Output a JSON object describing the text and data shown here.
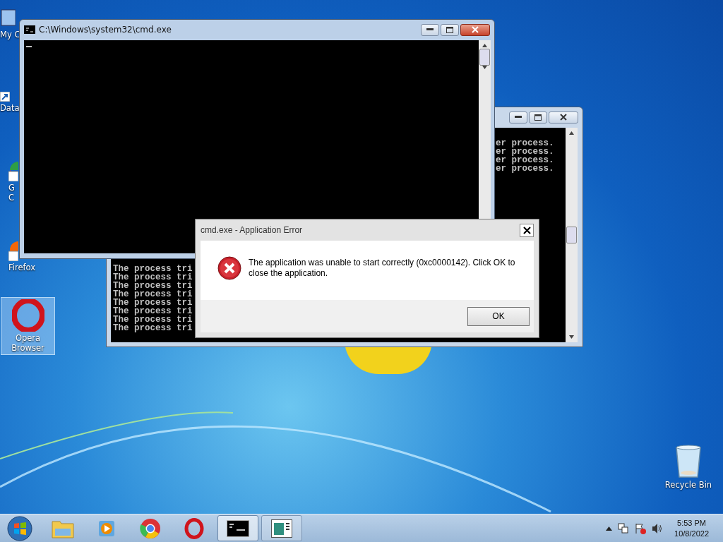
{
  "desktop_icons": [
    {
      "kind": "computer",
      "label": "My C",
      "selected": false
    },
    {
      "kind": "shortcut",
      "label": "Data",
      "selected": false
    },
    {
      "kind": "chrome",
      "label": "G\nC",
      "selected": false
    },
    {
      "kind": "firefox",
      "label": "Firefox",
      "selected": false
    },
    {
      "kind": "opera",
      "label": "Opera\nBrowser",
      "selected": true
    },
    {
      "kind": "recycle",
      "label": "Recycle Bin",
      "selected": false
    }
  ],
  "back_console": {
    "lines_right": [
      "er process.",
      "er process.",
      "er process.",
      "er process."
    ],
    "lines_left": [
      "The process tri",
      "The process tri",
      "The process tri",
      "The process tri",
      "The process tri",
      "The process tri",
      "The process tri",
      "The process tri"
    ]
  },
  "front_console": {
    "title": "C:\\Windows\\system32\\cmd.exe"
  },
  "dialog": {
    "title": "cmd.exe - Application Error",
    "message": "The application was unable to start correctly (0xc0000142). Click OK to close the application.",
    "button": "OK"
  },
  "taskbar": {
    "items": [
      {
        "kind": "explorer",
        "selected": false
      },
      {
        "kind": "media",
        "selected": false
      },
      {
        "kind": "chrome",
        "selected": false
      },
      {
        "kind": "opera",
        "selected": false
      },
      {
        "kind": "cmd",
        "selected": true
      },
      {
        "kind": "app",
        "selected": false
      }
    ],
    "clock": {
      "time": "5:53 PM",
      "date": "10/8/2022"
    }
  }
}
